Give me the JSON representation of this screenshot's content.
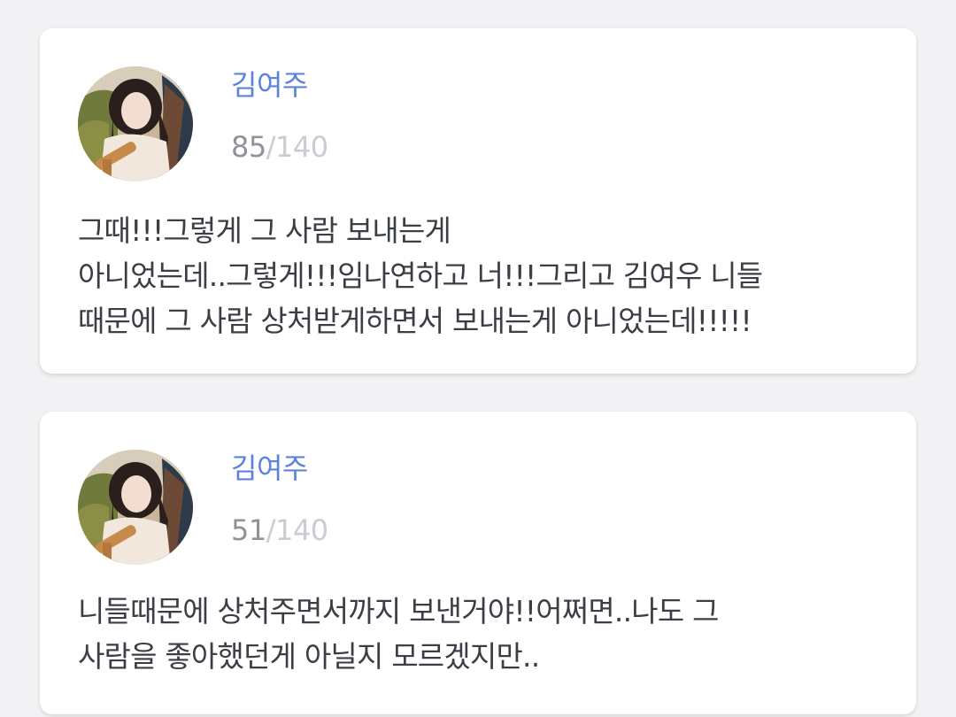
{
  "colors": {
    "name": "#5b82dd",
    "count_current": "#8f9399",
    "count_max": "#c9ccd1",
    "text": "#3b3e44",
    "background": "#f2f2f4",
    "card": "#ffffff"
  },
  "posts": [
    {
      "author": "김여주",
      "avatar_icon": "profile-photo",
      "char_count": "85",
      "separator": "/",
      "char_max": "140",
      "lines": [
        "그때!!!그렇게 그 사람 보내는게",
        "아니었는데..그렇게!!!임나연하고 너!!!그리고 김여우 니들",
        "때문에 그 사람 상처받게하면서 보내는게 아니었는데!!!!!"
      ]
    },
    {
      "author": "김여주",
      "avatar_icon": "profile-photo",
      "char_count": "51",
      "separator": "/",
      "char_max": "140",
      "lines": [
        "니들때문에 상처주면서까지 보낸거야!!어쩌면..나도 그",
        "사람을 좋아했던게 아닐지 모르겠지만.."
      ]
    }
  ]
}
